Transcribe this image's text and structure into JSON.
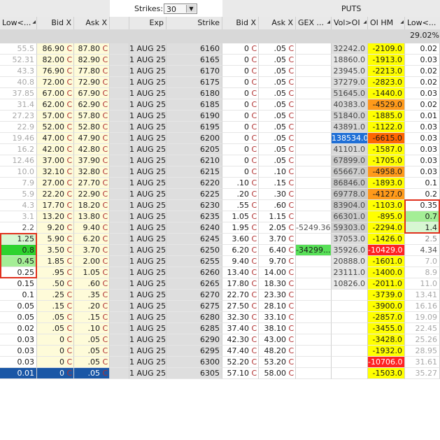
{
  "toolbar": {
    "strikes_label": "Strikes:",
    "strikes_value": "30",
    "strikes_arrow": "▼",
    "puts_label": "PUTS"
  },
  "headers": {
    "call_low": "Low<...",
    "call_bid": "Bid X",
    "call_ask": "Ask X",
    "exp": "Exp",
    "strike": "Strike",
    "put_bid": "Bid X",
    "put_ask": "Ask X",
    "gex": "GEX ...",
    "voloi": "Vol>OI",
    "oihm": "OI HM",
    "put_low": "Low<..."
  },
  "summary": {
    "put_low_total": "29.02%"
  },
  "colors": {
    "oi_yellow": "#ffff00",
    "oi_orange": "#ff9a1a",
    "oi_deep_orange": "#ff6600",
    "oi_red": "#ff2222",
    "voloi_blue": "#1f6fd6",
    "green_light": "#d7f7d2",
    "green_mid": "#a4ee96",
    "green_strong": "#2ed32e",
    "selected_row": "#1a57a6"
  },
  "rows": [
    {
      "call_low": "55.5",
      "call_bid": "86.90",
      "call_ask": "87.80",
      "exp": "1 AUG 25",
      "strike": "6160",
      "put_bid": "0",
      "put_ask": ".05",
      "gex": "",
      "voloi": "32242.0",
      "oihm": "-2109.0",
      "put_low": "0.02"
    },
    {
      "call_low": "52.31",
      "call_bid": "82.00",
      "call_ask": "82.90",
      "exp": "1 AUG 25",
      "strike": "6165",
      "put_bid": "0",
      "put_ask": ".05",
      "gex": "",
      "voloi": "18860.0",
      "oihm": "-1913.0",
      "put_low": "0.03"
    },
    {
      "call_low": "43.3",
      "call_bid": "76.90",
      "call_ask": "77.80",
      "exp": "1 AUG 25",
      "strike": "6170",
      "put_bid": "0",
      "put_ask": ".05",
      "gex": "",
      "voloi": "23945.0",
      "oihm": "-2213.0",
      "put_low": "0.02"
    },
    {
      "call_low": "40.8",
      "call_bid": "72.00",
      "call_ask": "72.90",
      "exp": "1 AUG 25",
      "strike": "6175",
      "put_bid": "0",
      "put_ask": ".05",
      "gex": "",
      "voloi": "37279.0",
      "oihm": "-2823.0",
      "put_low": "0.02"
    },
    {
      "call_low": "37.85",
      "call_bid": "67.00",
      "call_ask": "67.90",
      "exp": "1 AUG 25",
      "strike": "6180",
      "put_bid": "0",
      "put_ask": ".05",
      "gex": "",
      "voloi": "51645.0",
      "oihm": "-1440.0",
      "put_low": "0.03"
    },
    {
      "call_low": "31.4",
      "call_bid": "62.00",
      "call_ask": "62.90",
      "exp": "1 AUG 25",
      "strike": "6185",
      "put_bid": "0",
      "put_ask": ".05",
      "gex": "",
      "voloi": "40383.0",
      "oihm": "-4529.0",
      "put_low": "0.02"
    },
    {
      "call_low": "27.23",
      "call_bid": "57.00",
      "call_ask": "57.80",
      "exp": "1 AUG 25",
      "strike": "6190",
      "put_bid": "0",
      "put_ask": ".05",
      "gex": "",
      "voloi": "51840.0",
      "oihm": "-1885.0",
      "put_low": "0.01"
    },
    {
      "call_low": "22.9",
      "call_bid": "52.00",
      "call_ask": "52.80",
      "exp": "1 AUG 25",
      "strike": "6195",
      "put_bid": "0",
      "put_ask": ".05",
      "gex": "",
      "voloi": "43891.0",
      "oihm": "-1122.0",
      "put_low": "0.03"
    },
    {
      "call_low": "19.46",
      "call_bid": "47.00",
      "call_ask": "47.90",
      "exp": "1 AUG 25",
      "strike": "6200",
      "put_bid": "0",
      "put_ask": ".05",
      "gex": "",
      "voloi": "138534.0",
      "oihm": "-6615.0",
      "put_low": "0.03"
    },
    {
      "call_low": "16.2",
      "call_bid": "42.00",
      "call_ask": "42.80",
      "exp": "1 AUG 25",
      "strike": "6205",
      "put_bid": "0",
      "put_ask": ".05",
      "gex": "",
      "voloi": "41101.0",
      "oihm": "-1587.0",
      "put_low": "0.03"
    },
    {
      "call_low": "12.46",
      "call_bid": "37.00",
      "call_ask": "37.90",
      "exp": "1 AUG 25",
      "strike": "6210",
      "put_bid": "0",
      "put_ask": ".05",
      "gex": "",
      "voloi": "67899.0",
      "oihm": "-1705.0",
      "put_low": "0.03"
    },
    {
      "call_low": "10.0",
      "call_bid": "32.10",
      "call_ask": "32.80",
      "exp": "1 AUG 25",
      "strike": "6215",
      "put_bid": "0",
      "put_ask": ".10",
      "gex": "",
      "voloi": "65667.0",
      "oihm": "-4958.0",
      "put_low": "0.03"
    },
    {
      "call_low": "7.9",
      "call_bid": "27.00",
      "call_ask": "27.70",
      "exp": "1 AUG 25",
      "strike": "6220",
      "put_bid": ".10",
      "put_ask": ".15",
      "gex": "",
      "voloi": "86846.0",
      "oihm": "-1893.0",
      "put_low": "0.1"
    },
    {
      "call_low": "5.9",
      "call_bid": "22.20",
      "call_ask": "22.90",
      "exp": "1 AUG 25",
      "strike": "6225",
      "put_bid": ".20",
      "put_ask": ".30",
      "gex": "",
      "voloi": "69778.0",
      "oihm": "-4127.0",
      "put_low": "0.2"
    },
    {
      "call_low": "4.3",
      "call_bid": "17.70",
      "call_ask": "18.20",
      "exp": "1 AUG 25",
      "strike": "6230",
      "put_bid": ".55",
      "put_ask": ".60",
      "gex": "",
      "voloi": "83904.0",
      "oihm": "-1103.0",
      "put_low": "0.35"
    },
    {
      "call_low": "3.1",
      "call_bid": "13.20",
      "call_ask": "13.80",
      "exp": "1 AUG 25",
      "strike": "6235",
      "put_bid": "1.05",
      "put_ask": "1.15",
      "gex": "",
      "voloi": "66301.0",
      "oihm": "-895.0",
      "put_low": "0.7"
    },
    {
      "call_low": "2.2",
      "call_bid": "9.20",
      "call_ask": "9.40",
      "exp": "1 AUG 25",
      "strike": "6240",
      "put_bid": "1.95",
      "put_ask": "2.05",
      "gex": "-5249.36",
      "voloi": "59303.0",
      "oihm": "-2294.0",
      "put_low": "1.4"
    },
    {
      "call_low": "1.25",
      "call_bid": "5.90",
      "call_ask": "6.20",
      "exp": "1 AUG 25",
      "strike": "6245",
      "put_bid": "3.60",
      "put_ask": "3.70",
      "gex": "",
      "voloi": "37053.0",
      "oihm": "-1426.0",
      "put_low": "2.5"
    },
    {
      "call_low": "0.8",
      "call_bid": "3.50",
      "call_ask": "3.70",
      "exp": "1 AUG 25",
      "strike": "6250",
      "put_bid": "6.20",
      "put_ask": "6.40",
      "gex": "-34299....",
      "voloi": "35926.0",
      "oihm": "-10429.0",
      "put_low": "4.34"
    },
    {
      "call_low": "0.45",
      "call_bid": "1.85",
      "call_ask": "2.00",
      "exp": "1 AUG 25",
      "strike": "6255",
      "put_bid": "9.40",
      "put_ask": "9.70",
      "gex": "",
      "voloi": "20888.0",
      "oihm": "-1601.0",
      "put_low": "7.0"
    },
    {
      "call_low": "0.25",
      "call_bid": ".95",
      "call_ask": "1.05",
      "exp": "1 AUG 25",
      "strike": "6260",
      "put_bid": "13.40",
      "put_ask": "14.00",
      "gex": "",
      "voloi": "23111.0",
      "oihm": "-1400.0",
      "put_low": "8.9"
    },
    {
      "call_low": "0.15",
      "call_bid": ".50",
      "call_ask": ".60",
      "exp": "1 AUG 25",
      "strike": "6265",
      "put_bid": "17.80",
      "put_ask": "18.30",
      "gex": "",
      "voloi": "10826.0",
      "oihm": "-2011.0",
      "put_low": "11.0"
    },
    {
      "call_low": "0.1",
      "call_bid": ".25",
      "call_ask": ".35",
      "exp": "1 AUG 25",
      "strike": "6270",
      "put_bid": "22.70",
      "put_ask": "23.30",
      "gex": "",
      "voloi": "",
      "oihm": "-3739.0",
      "put_low": "13.41"
    },
    {
      "call_low": "0.05",
      "call_bid": ".15",
      "call_ask": ".20",
      "exp": "1 AUG 25",
      "strike": "6275",
      "put_bid": "27.50",
      "put_ask": "28.10",
      "gex": "",
      "voloi": "",
      "oihm": "-3900.0",
      "put_low": "16.16"
    },
    {
      "call_low": "0.05",
      "call_bid": ".05",
      "call_ask": ".15",
      "exp": "1 AUG 25",
      "strike": "6280",
      "put_bid": "32.30",
      "put_ask": "33.10",
      "gex": "",
      "voloi": "",
      "oihm": "-2857.0",
      "put_low": "19.09"
    },
    {
      "call_low": "0.02",
      "call_bid": ".05",
      "call_ask": ".10",
      "exp": "1 AUG 25",
      "strike": "6285",
      "put_bid": "37.40",
      "put_ask": "38.10",
      "gex": "",
      "voloi": "",
      "oihm": "-3455.0",
      "put_low": "22.45"
    },
    {
      "call_low": "0.03",
      "call_bid": "0",
      "call_ask": ".05",
      "exp": "1 AUG 25",
      "strike": "6290",
      "put_bid": "42.30",
      "put_ask": "43.00",
      "gex": "",
      "voloi": "",
      "oihm": "-3428.0",
      "put_low": "25.26"
    },
    {
      "call_low": "0.03",
      "call_bid": "0",
      "call_ask": ".05",
      "exp": "1 AUG 25",
      "strike": "6295",
      "put_bid": "47.40",
      "put_ask": "48.20",
      "gex": "",
      "voloi": "",
      "oihm": "-1932.0",
      "put_low": "28.95"
    },
    {
      "call_low": "0.03",
      "call_bid": "0",
      "call_ask": ".05",
      "exp": "1 AUG 25",
      "strike": "6300",
      "put_bid": "52.20",
      "put_ask": "53.20",
      "gex": "",
      "voloi": "",
      "oihm": "-10706.0",
      "put_low": "31.61"
    },
    {
      "call_low": "0.01",
      "call_bid": "0",
      "call_ask": ".05",
      "exp": "1 AUG 25",
      "strike": "6305",
      "put_bid": "57.10",
      "put_ask": "58.00",
      "gex": "",
      "voloi": "",
      "oihm": "-1503.0",
      "put_low": "35.27"
    }
  ]
}
